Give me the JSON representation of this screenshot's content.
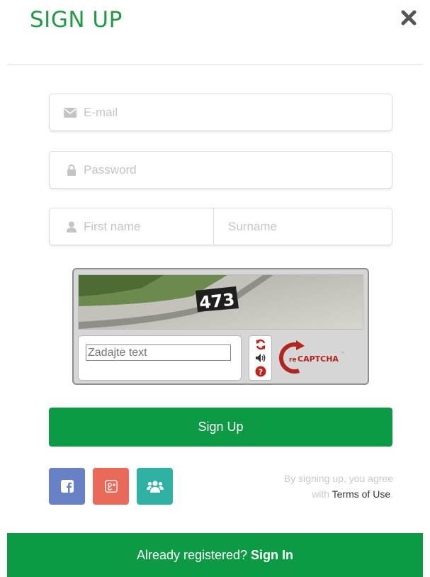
{
  "header": {
    "title": "SIGN UP",
    "close_icon": "close-icon"
  },
  "form": {
    "email_placeholder": "E-mail",
    "password_placeholder": "Password",
    "first_name_placeholder": "First name",
    "surname_placeholder": "Surname"
  },
  "captcha": {
    "image_text": "473",
    "input_placeholder": "Zadajte text",
    "logo_text": "CAPTCHA",
    "logo_prefix": "re",
    "logo_tm": "™",
    "icons": [
      "refresh-icon",
      "audio-icon",
      "help-icon"
    ]
  },
  "actions": {
    "signup_label": "Sign Up"
  },
  "social": {
    "icons": [
      "facebook-icon",
      "google-plus-icon",
      "group-icon"
    ]
  },
  "agreement": {
    "line1": "By signing up, you agree",
    "line2_prefix": "with",
    "terms_link": "Terms of Use",
    "line2_suffix": "."
  },
  "footer": {
    "prompt": "Already registered?",
    "signin_link": "Sign In"
  },
  "colors": {
    "brand_green": "#0d9a44",
    "title_green": "#1e9b45",
    "facebook": "#6880c6",
    "google_plus": "#ea6a5a",
    "group": "#2fb1a3"
  }
}
